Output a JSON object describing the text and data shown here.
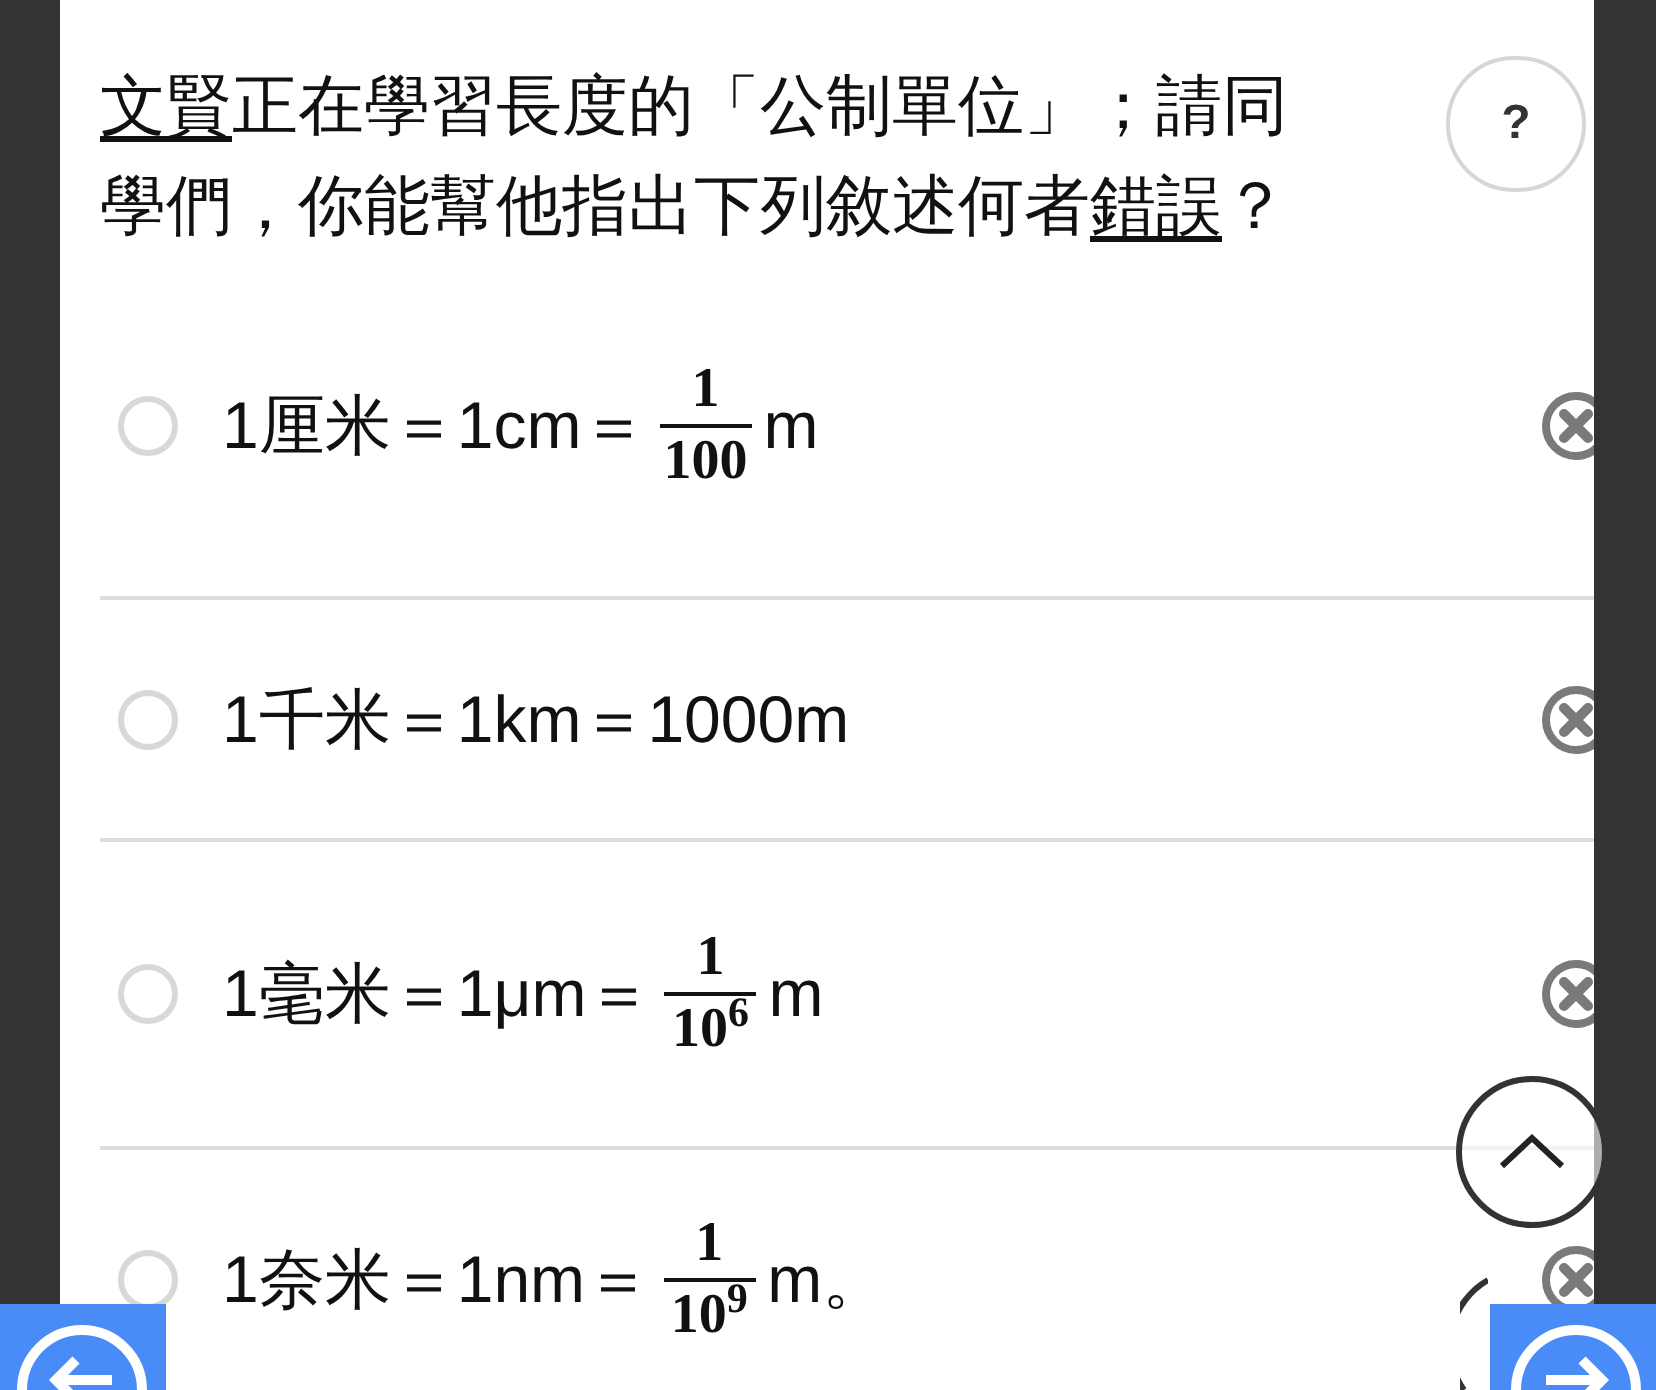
{
  "question": {
    "segments": [
      {
        "text": "文賢",
        "underlined": true
      },
      {
        "text": "正在學習長度的「公制單位」；請同學們，你能幫他指出下列敘述何者",
        "underlined": false
      },
      {
        "text": "錯誤",
        "underlined": true
      },
      {
        "text": "？",
        "underlined": false
      }
    ]
  },
  "help_button": {
    "label": "?"
  },
  "options": [
    {
      "kind": "fraction",
      "selected": false,
      "lhs": "1厘米＝1cm＝",
      "numerator": "1",
      "denominator": "100",
      "unit": "m"
    },
    {
      "kind": "plain",
      "selected": false,
      "text": "1千米＝1km＝1000m"
    },
    {
      "kind": "fraction",
      "selected": false,
      "lhs": "1毫米＝1μm＝",
      "numerator": "1",
      "denominator": "10$^{6}$",
      "unit": "m"
    },
    {
      "kind": "fraction",
      "selected": false,
      "lhs": "1奈米＝1nm＝",
      "numerator": "1",
      "denominator": "10$^{9}$",
      "unit": "m。"
    }
  ]
}
